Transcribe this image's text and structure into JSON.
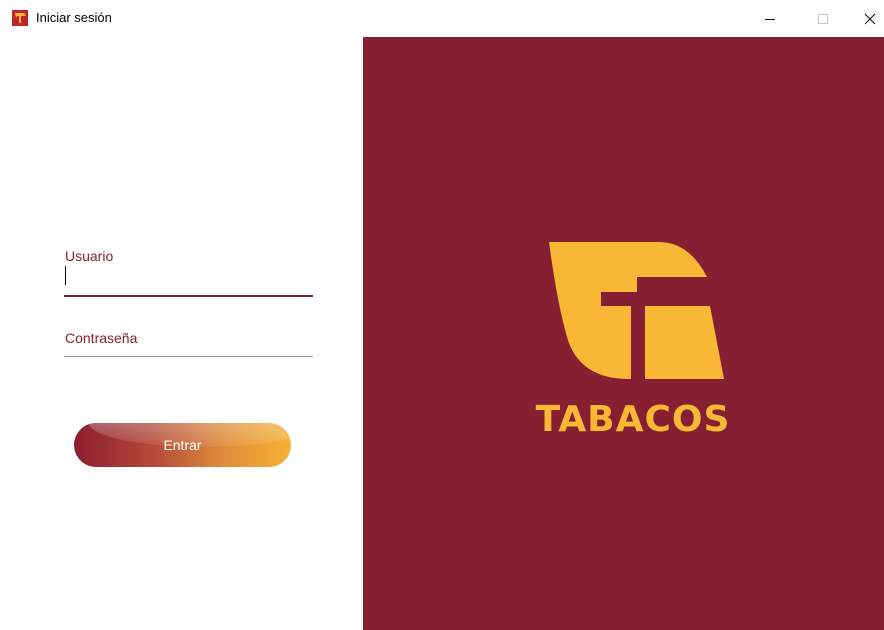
{
  "window": {
    "title": "Iniciar sesión",
    "icon": "tabacos-app-icon",
    "controls": [
      "minimize-icon",
      "maximize-icon",
      "close-icon"
    ]
  },
  "login": {
    "user_label": "Usuario",
    "user_value": "",
    "password_label": "Contraseña",
    "password_value": "",
    "submit_label": "Entrar"
  },
  "brand": {
    "name": "TABACOS",
    "logo": "tabacos-logo-icon"
  },
  "colors": {
    "brand_red": "#861f31",
    "brand_yellow": "#f8b835",
    "label_red": "#8a1f32"
  }
}
